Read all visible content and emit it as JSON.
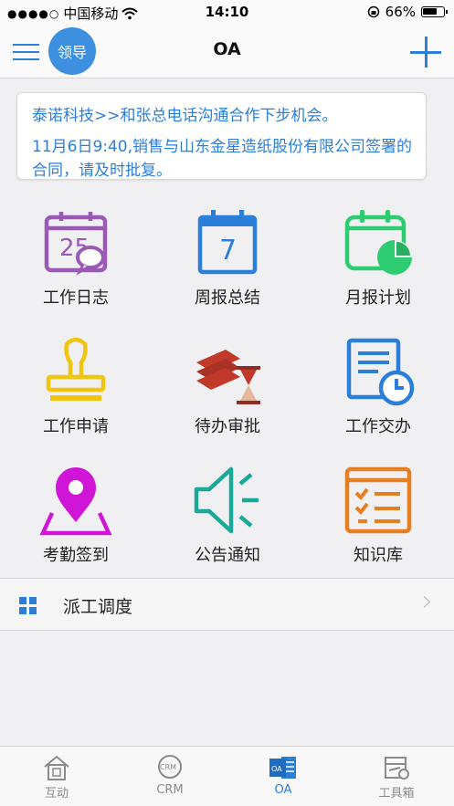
{
  "status_bar": {
    "carrier": "中国移动",
    "time": "14:10",
    "battery": "66%"
  },
  "nav": {
    "avatar_text": "领导",
    "title": "OA"
  },
  "notices": [
    {
      "text": "泰诺科技>>和张总电话沟通合作下步机会。"
    },
    {
      "text": "11月6日9:40,销售与山东金星造纸股份有限公司签署的合同，请及时批复。"
    }
  ],
  "grid": [
    {
      "label": "工作日志",
      "icon": "calendar-chat-icon",
      "color": "#9b59b6",
      "day": "25"
    },
    {
      "label": "周报总结",
      "icon": "calendar-icon",
      "color": "#2b7fd8",
      "day": "7"
    },
    {
      "label": "月报计划",
      "icon": "calendar-pie-icon",
      "color": "#2ecc71"
    },
    {
      "label": "工作申请",
      "icon": "stamp-icon",
      "color": "#f1c40f"
    },
    {
      "label": "待办审批",
      "icon": "books-hourglass-icon",
      "color": "#c0392b"
    },
    {
      "label": "工作交办",
      "icon": "document-clock-icon",
      "color": "#2b7fd8"
    },
    {
      "label": "考勤签到",
      "icon": "location-pin-icon",
      "color": "#d015d6"
    },
    {
      "label": "公告通知",
      "icon": "speaker-icon",
      "color": "#1aa899"
    },
    {
      "label": "知识库",
      "icon": "checklist-icon",
      "color": "#e67e22"
    }
  ],
  "dispatch": {
    "label": "派工调度",
    "icon": "grid-icon"
  },
  "tabs": [
    {
      "label": "互动",
      "icon": "house-icon",
      "active": false
    },
    {
      "label": "CRM",
      "icon": "crm-badge-icon",
      "badge": "CRM",
      "active": false
    },
    {
      "label": "OA",
      "icon": "oa-badge-icon",
      "badge": "OA",
      "active": true
    },
    {
      "label": "工具箱",
      "icon": "toolbox-icon",
      "active": false
    }
  ],
  "colors": {
    "accent": "#2b7fd8",
    "inactive": "#8a8a8a"
  }
}
